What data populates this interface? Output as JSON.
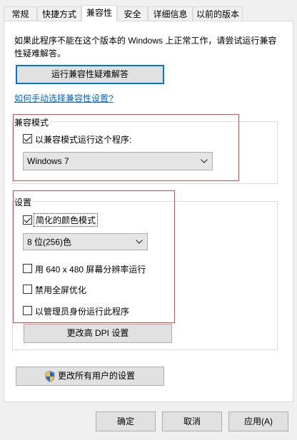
{
  "tabs": [
    {
      "label": "常规"
    },
    {
      "label": "快捷方式"
    },
    {
      "label": "兼容性"
    },
    {
      "label": "安全"
    },
    {
      "label": "详细信息"
    },
    {
      "label": "以前的版本"
    }
  ],
  "description": "如果此程序不能在这个版本的 Windows 上正常工作，请尝试运行兼容性疑难解答。",
  "troubleshoot_button": "运行兼容性疑难解答",
  "manual_link": "如何手动选择兼容性设置?",
  "compat_mode": {
    "title": "兼容模式",
    "checkbox_label": "以兼容模式运行这个程序:",
    "checked": true,
    "selected_os": "Windows 7"
  },
  "settings": {
    "title": "设置",
    "reduced_color_label": "简化的颜色模式",
    "reduced_color_checked": true,
    "color_depth": "8 位(256)色",
    "res_640_label": "用 640 x 480 屏幕分辨率运行",
    "fullscreen_opt_label": "禁用全屏优化",
    "admin_label": "以管理员身份运行此程序",
    "dpi_button": "更改高 DPI 设置"
  },
  "all_users_button": "更改所有用户的设置",
  "footer": {
    "ok": "确定",
    "cancel": "取消",
    "apply": "应用(A)"
  },
  "colors": {
    "accent": "#0078d7",
    "highlight_box": "#e24848",
    "link": "#0066cc"
  }
}
